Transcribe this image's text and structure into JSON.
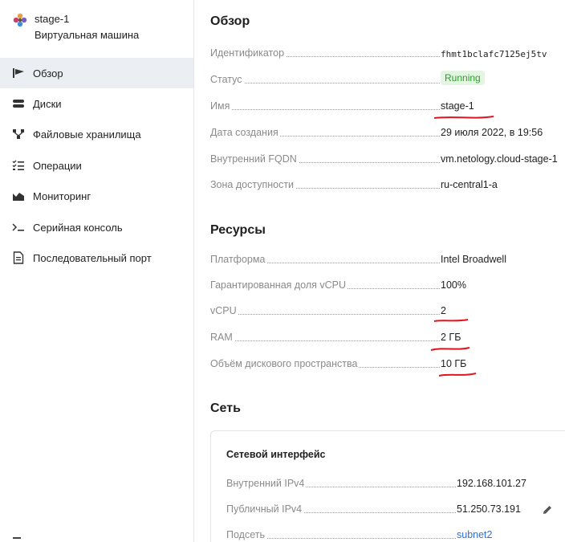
{
  "vm": {
    "name": "stage-1",
    "type": "Виртуальная машина"
  },
  "sidebar": {
    "items": [
      {
        "label": "Обзор",
        "icon": "overview-icon",
        "active": true
      },
      {
        "label": "Диски",
        "icon": "disk-icon"
      },
      {
        "label": "Файловые хранилища",
        "icon": "file-storage-icon"
      },
      {
        "label": "Операции",
        "icon": "operations-icon"
      },
      {
        "label": "Мониторинг",
        "icon": "monitoring-icon"
      },
      {
        "label": "Серийная консоль",
        "icon": "terminal-icon"
      },
      {
        "label": "Последовательный порт",
        "icon": "document-icon"
      }
    ]
  },
  "overview": {
    "title": "Обзор",
    "rows": [
      {
        "label": "Идентификатор",
        "value": "fhmt1bclafc7125ej5tv"
      },
      {
        "label": "Статус",
        "value": "Running"
      },
      {
        "label": "Имя",
        "value": "stage-1"
      },
      {
        "label": "Дата создания",
        "value": "29 июля 2022, в 19:56"
      },
      {
        "label": "Внутренний FQDN",
        "value": "vm.netology.cloud-stage-1"
      },
      {
        "label": "Зона доступности",
        "value": "ru-central1-a"
      }
    ]
  },
  "resources": {
    "title": "Ресурсы",
    "rows": [
      {
        "label": "Платформа",
        "value": "Intel Broadwell"
      },
      {
        "label": "Гарантированная доля vCPU",
        "value": "100%"
      },
      {
        "label": "vCPU",
        "value": "2"
      },
      {
        "label": "RAM",
        "value": "2 ГБ"
      },
      {
        "label": "Объём дискового пространства",
        "value": "10 ГБ"
      }
    ]
  },
  "network": {
    "title": "Сеть",
    "card_title": "Сетевой интерфейс",
    "rows": [
      {
        "label": "Внутренний IPv4",
        "value": "192.168.101.27"
      },
      {
        "label": "Публичный IPv4",
        "value": "51.250.73.191"
      },
      {
        "label": "Подсеть",
        "value": "subnet2"
      }
    ]
  },
  "colors": {
    "active_nav_bg": "#ebeef2",
    "status_bg": "#e4f5e2",
    "status_text": "#2f9e2f",
    "link": "#2f6fdc",
    "annotation": "#e0141e"
  }
}
